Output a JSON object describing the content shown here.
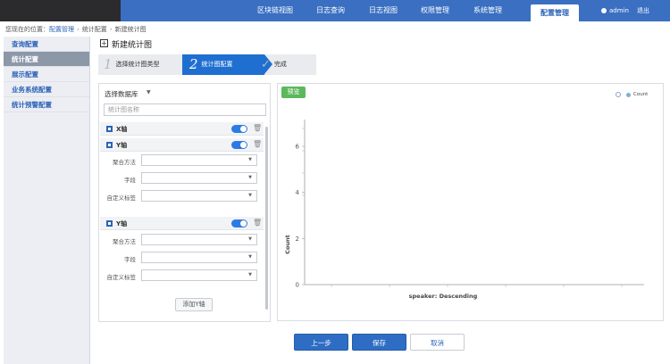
{
  "nav": {
    "items": [
      "区块链视图",
      "日志查询",
      "日志视图",
      "权限管理",
      "系统管理",
      "配置管理"
    ],
    "active": "配置管理",
    "user": "admin",
    "logout": "退出"
  },
  "breadcrumb": {
    "prefix": "您现在的位置：",
    "items": [
      "配置管理",
      "统计配置",
      "新建统计图"
    ]
  },
  "sidebar": {
    "items": [
      "查询配置",
      "统计配置",
      "展示配置",
      "业务系统配置",
      "统计预警配置"
    ],
    "active_index": 1
  },
  "page": {
    "title": "新建统计图"
  },
  "steps": [
    {
      "num": "1",
      "label": "选择统计图类型"
    },
    {
      "num": "2",
      "label": "统计图配置"
    },
    {
      "num": "✓",
      "label": "完成"
    }
  ],
  "config": {
    "datasource_label": "选择数据库",
    "chart_name_placeholder": "统计图名称",
    "x_axis_label": "X轴",
    "y_axis_label": "Y轴",
    "y_axis2_label": "Y轴",
    "agg_label": "聚合方法",
    "field_label": "字段",
    "custom_label": "自定义标签",
    "add_y_button": "添加Y轴"
  },
  "preview": {
    "button": "预览",
    "legend": "Count"
  },
  "chart_data": {
    "type": "bar",
    "categories": [],
    "series": [
      {
        "name": "Count",
        "values": []
      }
    ],
    "xlabel": "speaker: Descending",
    "ylabel": "Count",
    "yticks": [
      "0",
      "2",
      "4",
      "6"
    ],
    "ylim": [
      0,
      6
    ],
    "grid": false,
    "legend": "top-right"
  },
  "actions": {
    "prev": "上一步",
    "save": "保存",
    "cancel": "取消"
  },
  "colors": {
    "topbar": "#3a6fc2",
    "accent": "#1f6fd1",
    "preview_green": "#5cb85c"
  }
}
